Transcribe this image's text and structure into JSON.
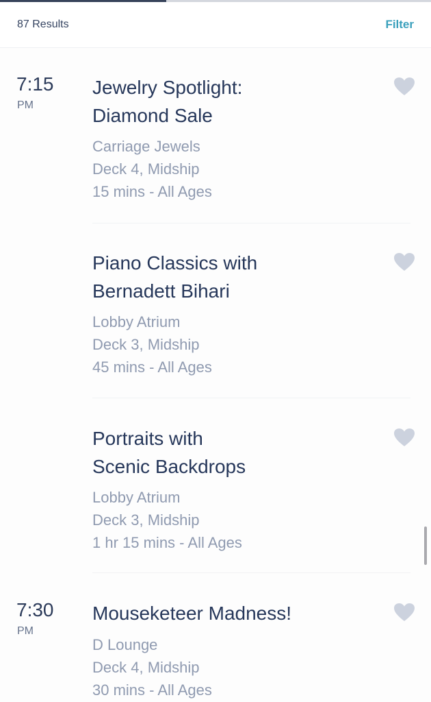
{
  "progress": {
    "fraction": 0.386
  },
  "header": {
    "results_label": "87 Results",
    "filter_label": "Filter"
  },
  "colors": {
    "accent": "#3aa0bc",
    "title": "#26375a",
    "meta": "#8f9ab0",
    "heart": "#ccd2de"
  },
  "events": [
    {
      "time": "7:15",
      "ampm": "PM",
      "title_lines": [
        "Jewelry Spotlight:",
        "Diamond Sale"
      ],
      "venue": "Carriage Jewels",
      "location": "Deck 4, Midship",
      "duration": "15 mins - All Ages",
      "favorite_icon": "heart-icon"
    },
    {
      "time": "",
      "ampm": "",
      "title_lines": [
        "Piano Classics with",
        "Bernadett Bihari"
      ],
      "venue": "Lobby Atrium",
      "location": "Deck 3, Midship",
      "duration": "45 mins - All Ages",
      "favorite_icon": "heart-icon"
    },
    {
      "time": "",
      "ampm": "",
      "title_lines": [
        "Portraits with",
        "Scenic Backdrops"
      ],
      "venue": "Lobby Atrium",
      "location": "Deck 3, Midship",
      "duration": "1 hr 15 mins - All Ages",
      "favorite_icon": "heart-icon"
    },
    {
      "time": "7:30",
      "ampm": "PM",
      "title_lines": [
        "Mouseketeer Madness!"
      ],
      "venue": "D Lounge",
      "location": "Deck 4, Midship",
      "duration": "30 mins - All Ages",
      "favorite_icon": "heart-icon"
    }
  ]
}
